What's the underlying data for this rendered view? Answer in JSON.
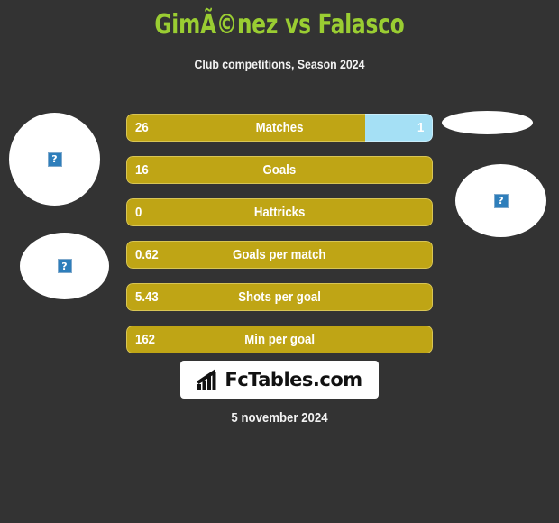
{
  "header": {
    "title": "GimÃ©nez vs Falasco",
    "subtitle": "Club competitions, Season 2024"
  },
  "footer": {
    "date": "5 november 2024"
  },
  "avatars": {
    "placeholder_glyph": "?",
    "home_top_name": "home-player-photo-top",
    "home_bottom_name": "home-club-logo",
    "away_top_name": "away-player-photo-top",
    "away_bottom_name": "away-club-logo"
  },
  "colors": {
    "background": "#333333",
    "title": "#9ACD32",
    "home_bar": "#BFA515",
    "home_bar_border": "#D8C555",
    "away_bar": "#A5E0F5",
    "away_bar_border": "#C9EDFA",
    "text": "#FFFFFF"
  },
  "logo": {
    "text": "FcTables.com",
    "icon": "bar-chart-icon"
  },
  "chart_data": {
    "type": "bar",
    "title": "GimÃ©nez vs Falasco",
    "subtitle": "Club competitions, Season 2024",
    "orientation": "horizontal-diverging",
    "series": [
      {
        "name": "GimÃ©nez",
        "side": "home",
        "values": [
          26,
          16,
          0,
          0.62,
          5.43,
          162
        ]
      },
      {
        "name": "Falasco",
        "side": "away",
        "values": [
          1,
          null,
          null,
          null,
          null,
          null
        ]
      }
    ],
    "categories": [
      "Matches",
      "Goals",
      "Hattricks",
      "Goals per match",
      "Shots per goal",
      "Min per goal"
    ],
    "legend": "none",
    "grid": false
  },
  "rows": [
    {
      "label": "Matches",
      "home_value": "26",
      "away_value": "1",
      "home_pct": 78,
      "away_pct": 22,
      "has_away": true
    },
    {
      "label": "Goals",
      "home_value": "16",
      "away_value": "",
      "home_pct": 100,
      "away_pct": 0,
      "has_away": false
    },
    {
      "label": "Hattricks",
      "home_value": "0",
      "away_value": "",
      "home_pct": 100,
      "away_pct": 0,
      "has_away": false
    },
    {
      "label": "Goals per match",
      "home_value": "0.62",
      "away_value": "",
      "home_pct": 100,
      "away_pct": 0,
      "has_away": false
    },
    {
      "label": "Shots per goal",
      "home_value": "5.43",
      "away_value": "",
      "home_pct": 100,
      "away_pct": 0,
      "has_away": false
    },
    {
      "label": "Min per goal",
      "home_value": "162",
      "away_value": "",
      "home_pct": 100,
      "away_pct": 0,
      "has_away": false
    }
  ]
}
